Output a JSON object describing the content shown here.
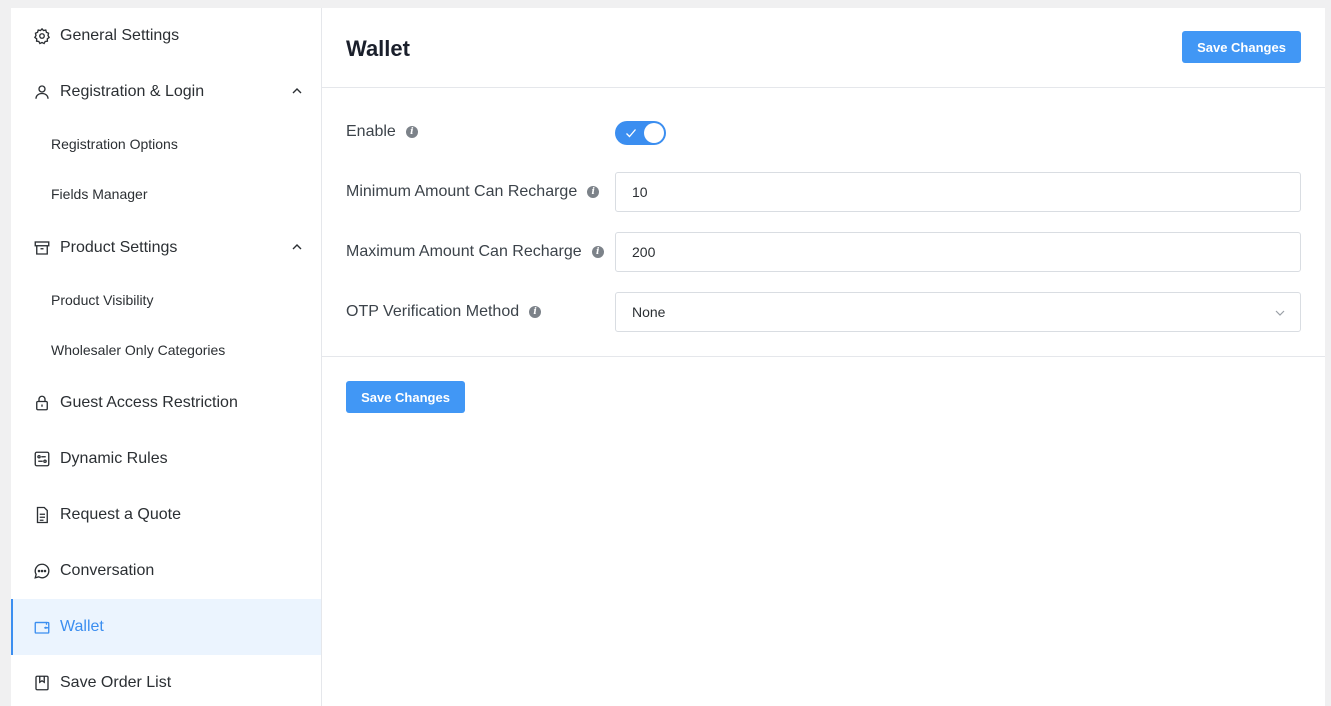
{
  "sidebar": {
    "items": [
      {
        "label": "General Settings"
      },
      {
        "label": "Registration & Login"
      },
      {
        "label": "Registration Options"
      },
      {
        "label": "Fields Manager"
      },
      {
        "label": "Product Settings"
      },
      {
        "label": "Product Visibility"
      },
      {
        "label": "Wholesaler Only Categories"
      },
      {
        "label": "Guest Access Restriction"
      },
      {
        "label": "Dynamic Rules"
      },
      {
        "label": "Request a Quote"
      },
      {
        "label": "Conversation"
      },
      {
        "label": "Wallet"
      },
      {
        "label": "Save Order List"
      }
    ],
    "active_color": "#3b8ef0"
  },
  "header": {
    "title": "Wallet",
    "save_label": "Save Changes"
  },
  "form": {
    "enable_label": "Enable",
    "enable_value": true,
    "min_label": "Minimum Amount Can Recharge",
    "min_value": "10",
    "max_label": "Maximum Amount Can Recharge",
    "max_value": "200",
    "otp_label": "OTP Verification Method",
    "otp_value": "None"
  },
  "footer": {
    "save_label": "Save Changes"
  },
  "colors": {
    "accent": "#4197f5"
  }
}
